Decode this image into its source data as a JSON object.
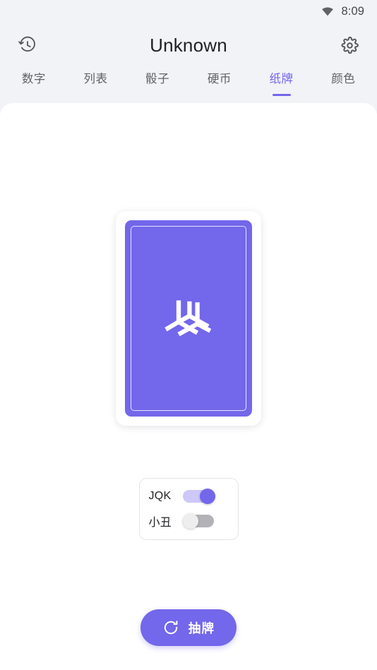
{
  "status_bar": {
    "wifi_icon": "wifi-icon",
    "time": "8:09"
  },
  "app_bar": {
    "history_icon": "history-icon",
    "title": "Unknown",
    "settings_icon": "gear-icon"
  },
  "tabs": [
    {
      "label": "数字",
      "active": false
    },
    {
      "label": "列表",
      "active": false
    },
    {
      "label": "骰子",
      "active": false
    },
    {
      "label": "硬币",
      "active": false
    },
    {
      "label": "纸牌",
      "active": true
    },
    {
      "label": "颜色",
      "active": false
    }
  ],
  "card": {
    "face": "card-back",
    "logo_icon": "pinwheel-logo-icon",
    "back_color": "#7367eb",
    "border_color": "#ffffff"
  },
  "options": [
    {
      "label": "JQK",
      "state": "on"
    },
    {
      "label": "小丑",
      "state": "off"
    }
  ],
  "draw_button": {
    "icon": "refresh-icon",
    "label": "抽牌"
  },
  "theme": {
    "accent": "#7367eb",
    "accent_light": "#cdc8f7",
    "background": "#f2f3f7",
    "panel": "#ffffff",
    "text_primary": "#1f2024",
    "text_secondary": "#5f6268"
  }
}
